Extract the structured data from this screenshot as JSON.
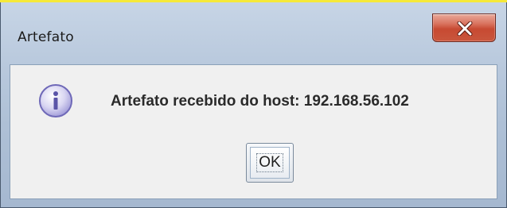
{
  "window": {
    "title": "Artefato"
  },
  "dialog": {
    "icon": "info-icon",
    "message": "Artefato recebido do host: 192.168.56.102",
    "ok_label": "OK"
  },
  "titlebar": {
    "close_icon": "close-icon"
  },
  "colors": {
    "close_button": "#c74a32",
    "client_background": "#f0f0f0",
    "frame": "#aec0d6"
  }
}
